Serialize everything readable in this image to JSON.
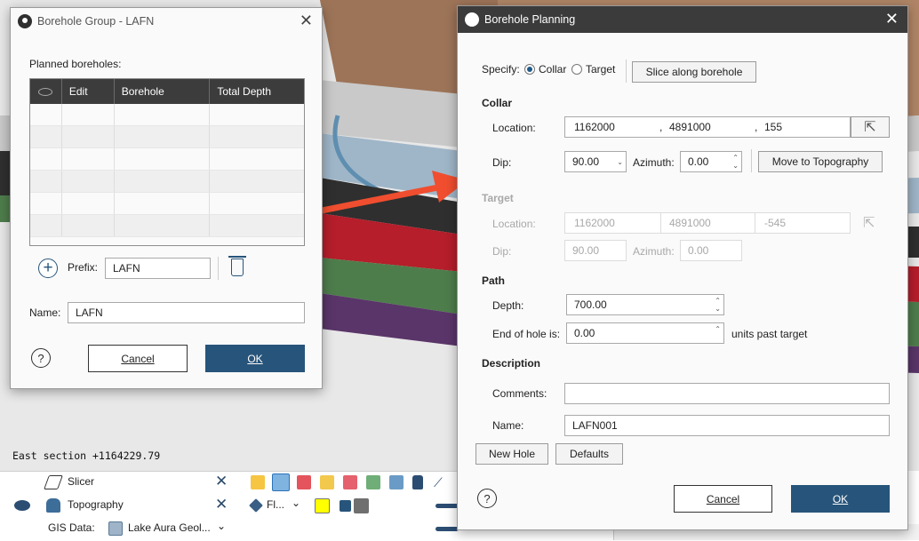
{
  "scene": {
    "section_label": "East section +1164229.79"
  },
  "tree": {
    "rows": [
      {
        "label": "Slicer"
      },
      {
        "label": "Topography",
        "style_label": "Fl..."
      },
      {
        "label": "GIS Data:",
        "value": "Lake Aura Geol..."
      }
    ]
  },
  "group_dialog": {
    "title": "Borehole Group - LAFN",
    "planned_label": "Planned boreholes:",
    "columns": [
      "",
      "Edit",
      "Borehole",
      "Total Depth"
    ],
    "prefix_label": "Prefix:",
    "prefix_value": "LAFN",
    "name_label": "Name:",
    "name_value": "LAFN",
    "help": "?",
    "cancel": "Cancel",
    "ok": "OK"
  },
  "planning_dialog": {
    "title": "Borehole Planning",
    "specify_label": "Specify:",
    "specify_options": [
      "Collar",
      "Target"
    ],
    "slice_button": "Slice along borehole",
    "collar": {
      "heading": "Collar",
      "location_label": "Location:",
      "x": "1162000",
      "y": "4891000",
      "z": "155",
      "dip_label": "Dip:",
      "dip": "90.00",
      "azimuth_label": "Azimuth:",
      "azimuth": "0.00",
      "move_button": "Move to Topography"
    },
    "target": {
      "heading": "Target",
      "location_label": "Location:",
      "x": "1162000",
      "y": "4891000",
      "z": "-545",
      "dip_label": "Dip:",
      "dip": "90.00",
      "azimuth_label": "Azimuth:",
      "azimuth": "0.00"
    },
    "path": {
      "heading": "Path",
      "depth_label": "Depth:",
      "depth": "700.00",
      "end_label": "End of hole is:",
      "end_value": "0.00",
      "end_suffix": "units past target"
    },
    "description": {
      "heading": "Description",
      "comments_label": "Comments:",
      "comments": "",
      "name_label": "Name:",
      "name": "LAFN001"
    },
    "new_hole": "New Hole",
    "defaults": "Defaults",
    "help": "?",
    "cancel": "Cancel",
    "ok": "OK"
  },
  "colors": {
    "accent": "#27547a",
    "arrow": "#f04e2f",
    "header": "#3c3c3c"
  }
}
